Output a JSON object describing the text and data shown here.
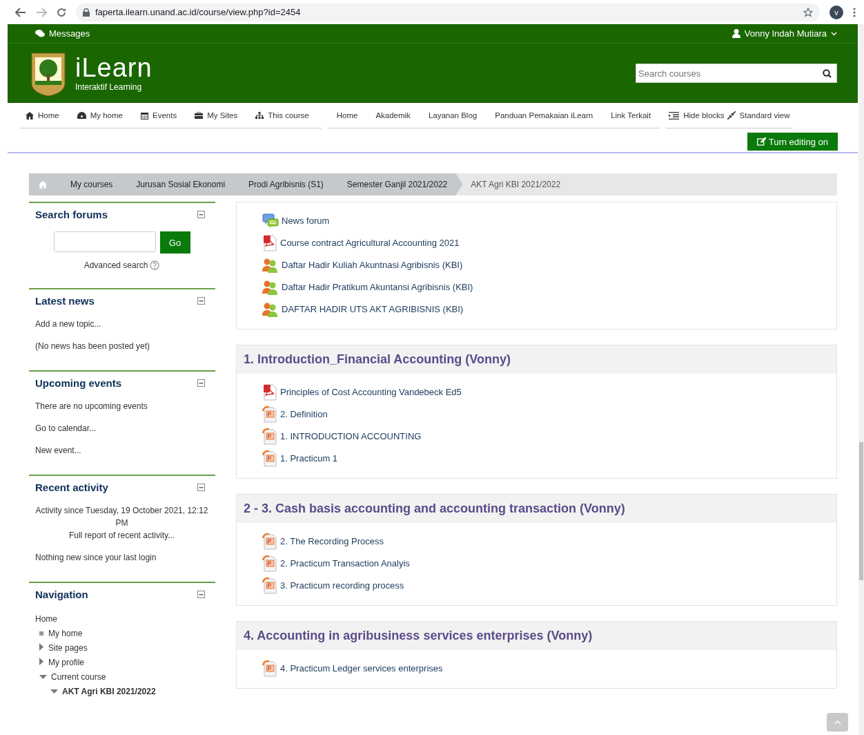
{
  "browser": {
    "url": "faperta.ilearn.unand.ac.id/course/view.php?id=2454",
    "avatar": "v"
  },
  "header": {
    "messages": "Messages",
    "user": "Vonny Indah Mutiara",
    "logo_title": "iLearn",
    "logo_subtitle": "Interaktif Learning",
    "search": {
      "placeholder": "Search courses"
    }
  },
  "nav_left": [
    {
      "label": "Home",
      "kind": "home"
    },
    {
      "label": "My home",
      "kind": "dashboard"
    },
    {
      "label": "Events",
      "kind": "calendar"
    },
    {
      "label": "My Sites",
      "kind": "briefcase"
    },
    {
      "label": "This course",
      "kind": "sitemap"
    }
  ],
  "nav_middle": [
    "Home",
    "Akademik",
    "Layanan Blog",
    "Panduan Pemakaian iLearn",
    "Link Terkait"
  ],
  "nav_right": [
    {
      "label": "Hide blocks",
      "kind": "outdent"
    },
    {
      "label": "Standard view",
      "kind": "compress"
    }
  ],
  "edit_button": "Turn editing on",
  "breadcrumb": [
    "My courses",
    "Jurusan Sosial Ekonomi",
    "Prodi Agribisnis (S1)",
    "Semester Ganjil 2021/2022",
    "AKT Agri KBI 2021/2022"
  ],
  "blocks": [
    {
      "kind": "search",
      "title": "Search forums",
      "button": "Go",
      "link": "Advanced search"
    },
    {
      "kind": "lines",
      "title": "Latest news",
      "lines": [
        {
          "text": "Add a new topic...",
          "kind": "plain"
        },
        {
          "text": "(No news has been posted yet)",
          "kind": "plain"
        }
      ]
    },
    {
      "kind": "lines",
      "title": "Upcoming events",
      "lines": [
        {
          "text": "There are no upcoming events",
          "kind": "plain"
        },
        {
          "text": "Go to calendar...",
          "kind": "plain"
        },
        {
          "text": "New event...",
          "kind": "plain"
        }
      ]
    },
    {
      "kind": "lines",
      "title": "Recent activity",
      "lines": [
        {
          "text": "Activity since Tuesday, 19 October 2021, 12:12 PM",
          "kind": "centered"
        },
        {
          "text": "Full report of recent activity...",
          "kind": "centered"
        },
        {
          "text": "Nothing new since your last login",
          "kind": "plain"
        }
      ]
    },
    {
      "kind": "tree",
      "title": "Navigation",
      "tree": [
        {
          "label": "Home",
          "kind": "root",
          "children": [
            {
              "label": "My home",
              "kind": "leaf"
            },
            {
              "label": "Site pages",
              "kind": "branch",
              "expanded": false
            },
            {
              "label": "My profile",
              "kind": "branch",
              "expanded": false
            },
            {
              "label": "Current course",
              "kind": "branch",
              "expanded": true,
              "children": [
                {
                  "label": "AKT Agri KBI 2021/2022",
                  "kind": "current",
                  "expanded": true
                }
              ]
            }
          ]
        }
      ]
    }
  ],
  "sections": [
    {
      "items": [
        {
          "label": "News forum",
          "kind": "forum"
        },
        {
          "label": "Course contract Agricultural Accounting 2021",
          "kind": "pdf"
        },
        {
          "label": "Daftar Hadir Kuliah Akuntnasi Agribisnis (KBI)",
          "kind": "attendance"
        },
        {
          "label": "Daftar Hadir Pratikum Akuntansi Agribisnis (KBI)",
          "kind": "attendance"
        },
        {
          "label": "DAFTAR HADIR UTS AKT AGRIBISNIS (KBI)",
          "kind": "attendance"
        }
      ]
    },
    {
      "title": "1. Introduction_Financial Accounting (Vonny)",
      "items": [
        {
          "label": "Principles of Cost Accounting Vandebeck Ed5",
          "kind": "pdf"
        },
        {
          "label": "2. Definition",
          "kind": "ppt"
        },
        {
          "label": "1. INTRODUCTION ACCOUNTING",
          "kind": "ppt"
        },
        {
          "label": "1. Practicum 1",
          "kind": "ppt"
        }
      ]
    },
    {
      "title": "2 - 3. Cash basis accounting and accounting transaction (Vonny)",
      "items": [
        {
          "label": "2. The Recording Process",
          "kind": "ppt"
        },
        {
          "label": "2. Practicum Transaction Analyis",
          "kind": "ppt"
        },
        {
          "label": "3. Practicum recording process",
          "kind": "ppt"
        }
      ]
    },
    {
      "title": "4. Accounting in agribusiness services enterprises (Vonny)",
      "items": [
        {
          "label": "4. Practicum Ledger services enterprises",
          "kind": "ppt"
        }
      ]
    }
  ]
}
